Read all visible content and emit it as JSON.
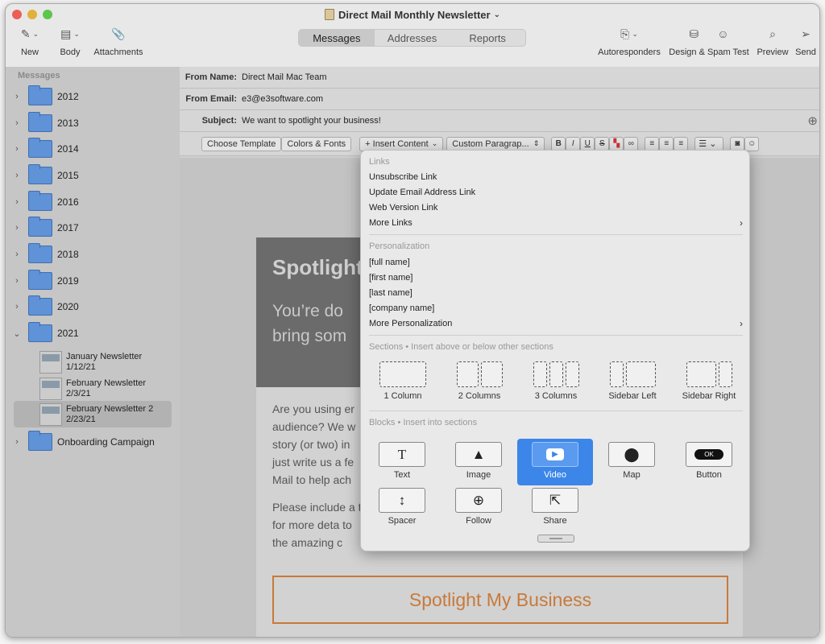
{
  "window": {
    "title": "Direct Mail Monthly Newsletter"
  },
  "toolbar": {
    "new": "New",
    "body": "Body",
    "attachments": "Attachments",
    "tabs": [
      "Messages",
      "Addresses",
      "Reports"
    ],
    "autoresponders": "Autoresponders",
    "design_spam": "Design & Spam Test",
    "preview": "Preview",
    "send": "Send"
  },
  "sidebar": {
    "heading": "Messages",
    "folders": [
      "2012",
      "2013",
      "2014",
      "2015",
      "2016",
      "2017",
      "2018",
      "2019",
      "2020",
      "2021"
    ],
    "messages": [
      {
        "title": "January Newsletter",
        "date": "1/12/21"
      },
      {
        "title": "February Newsletter",
        "date": "2/3/21"
      },
      {
        "title": "February Newsletter 2",
        "date": "2/23/21"
      }
    ],
    "extra_folder": "Onboarding Campaign"
  },
  "header": {
    "from_name_label": "From Name:",
    "from_name": "Direct Mail Mac Team",
    "from_email_label": "From Email:",
    "from_email": "e3@e3software.com",
    "subject_label": "Subject:",
    "subject": "We want to spotlight your business!"
  },
  "format_bar": {
    "choose_template": "Choose Template",
    "colors_fonts": "Colors & Fonts",
    "insert_content": "+ Insert Content",
    "paragraph_style": "Custom Paragrap..."
  },
  "email": {
    "hero_title": "Spotlight",
    "hero_sub": "You’re do bring som",
    "para1": "Are you using er audience? We w story (or two) in just write us a fe Mail to help ach",
    "para2": "Please include a to for more deta to the amazing c",
    "cta": "Spotlight My Business"
  },
  "menu": {
    "links_head": "Links",
    "links": [
      "Unsubscribe Link",
      "Update Email Address Link",
      "Web Version Link",
      "More Links"
    ],
    "person_head": "Personalization",
    "person": [
      "[full name]",
      "[first name]",
      "[last name]",
      "[company name]",
      "More Personalization"
    ],
    "sections_head": "Sections • Insert above or below other sections",
    "sections": [
      "1 Column",
      "2 Columns",
      "3 Columns",
      "Sidebar Left",
      "Sidebar Right"
    ],
    "blocks_head": "Blocks • Insert into sections",
    "blocks": [
      "Text",
      "Image",
      "Video",
      "Map",
      "Button",
      "Spacer",
      "Follow",
      "Share"
    ],
    "ok_label": "OK"
  },
  "colors": {
    "selected": "#3b86e8",
    "cta": "#c87a3a",
    "folder": "#5f92d6"
  }
}
